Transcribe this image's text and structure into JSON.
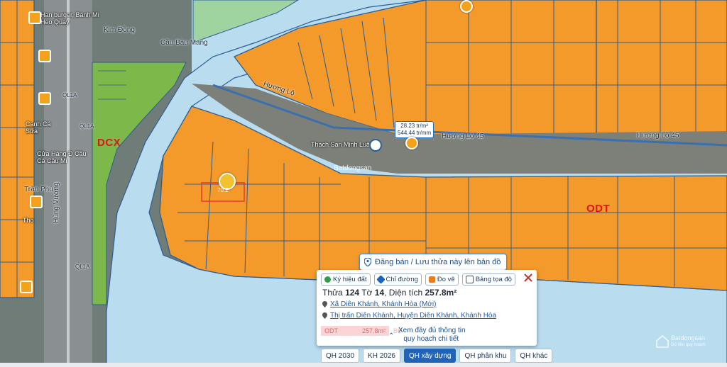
{
  "map": {
    "zones": {
      "left": "DCX",
      "right": "ODT"
    },
    "roads": [
      "Kim Đồng",
      "Cầu Bàu Mang",
      "Hương Lộ",
      "Hương Lộ 45",
      "Hương Lộ 45",
      "QL1A",
      "QL1A",
      "QL1A",
      "Trần Phú",
      "Hùng Vương"
    ],
    "pois": [
      "Han burger, Bánh Mì Heo Quay",
      "Canh Cá Sữa",
      "Cửa Hàng Đ Cầu Cá Cầu Mi",
      "Tho",
      "Thạch Sạn Minh Luân"
    ],
    "prices": {
      "line1": "28.23 tr/m²",
      "line2": "544.44 tr/mm"
    },
    "parcel_label": "70.2",
    "map_watermark": "Batdongsan"
  },
  "hint_label": "Đăng bán / Lưu thửa này lên bản đồ",
  "panel": {
    "chips": [
      {
        "label": "Ký hiệu đất",
        "icon": "leaf-icon",
        "color": "#2f9e44"
      },
      {
        "label": "Chỉ đường",
        "icon": "direction-icon",
        "color": "#1f64ba"
      },
      {
        "label": "Đo vẽ",
        "icon": "ruler-icon",
        "color": "#e67e22"
      },
      {
        "label": "Bảng tọa độ",
        "icon": "table-icon",
        "color": "#555555"
      }
    ],
    "parcel": {
      "prefix": "Thửa",
      "plot": "124",
      "sheet_label": "Tờ",
      "sheet": "14",
      "area_label": ", Diện tích",
      "area": "257.8m²"
    },
    "addr_new": "Xã Diên Khánh, Khánh Hòa (Mới)",
    "addr_old": "Thị trấn Diên Khánh, Huyện Diên Khánh, Khánh Hòa",
    "zone_code": "ODT",
    "zone_area": "257.8m²",
    "zone_extra": "BĐ",
    "more_line1": "Xem đầy đủ thông tin",
    "more_line2": "quy hoạch chi tiết"
  },
  "tabs": [
    {
      "label": "QH 2030",
      "active": false
    },
    {
      "label": "KH 2026",
      "active": false
    },
    {
      "label": "QH xây dựng",
      "active": true
    },
    {
      "label": "QH phân khu",
      "active": false
    },
    {
      "label": "QH khác",
      "active": false
    }
  ],
  "watermark": {
    "line1": "Batdongsan",
    "line2": "Dữ liệu quy hoạch"
  },
  "colors": {
    "residential": "#f49a2a",
    "river": "#b9dcef",
    "green": "#7db84a",
    "parcel_line": "#2b5e97",
    "accent": "#1f64ba"
  }
}
